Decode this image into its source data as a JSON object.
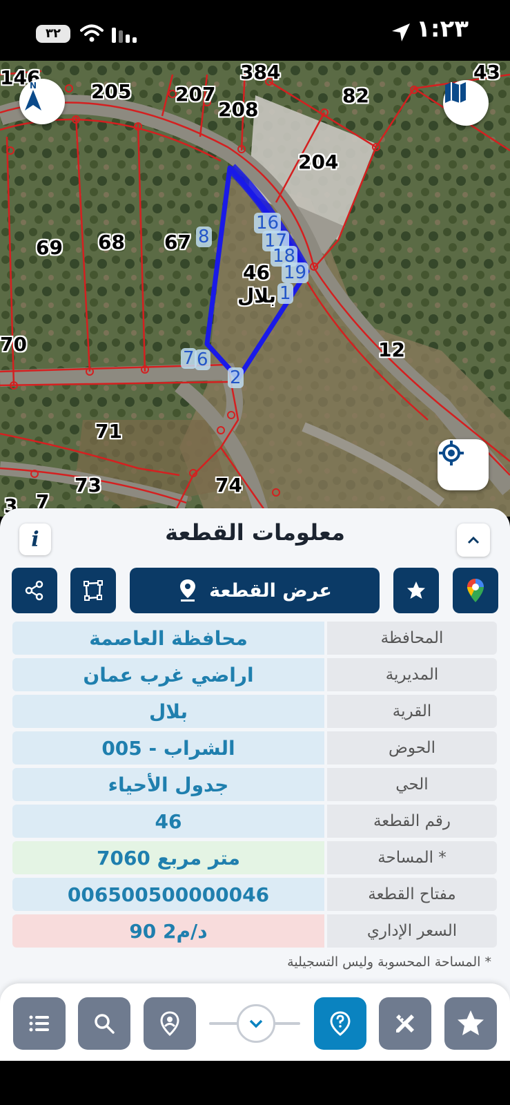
{
  "status_bar": {
    "time": "١:٢٣",
    "battery": "٣٢"
  },
  "map": {
    "parcel_labels": [
      "146",
      "205",
      "207",
      "384",
      "43",
      "82",
      "208",
      "204",
      "69",
      "68",
      "67",
      "46",
      "70",
      "12",
      "71",
      "73",
      "74",
      "3",
      "7"
    ],
    "village_label": "بلال",
    "boundary_points": [
      "8",
      "16",
      "17",
      "18",
      "19",
      "1",
      "2",
      "7",
      "6"
    ],
    "compass_label": "N"
  },
  "panel": {
    "title": "معلومات القطعة",
    "show_parcel_button": "عرض القطعة",
    "rows": [
      {
        "key": "المحافظة",
        "value": "محافظة العاصمة",
        "tone": "blue"
      },
      {
        "key": "المديرية",
        "value": "اراضي غرب عمان",
        "tone": "blue"
      },
      {
        "key": "القرية",
        "value": "بلال",
        "tone": "blue"
      },
      {
        "key": "الحوض",
        "value": "الشراب - 005",
        "tone": "blue"
      },
      {
        "key": "الحي",
        "value": "جدول الأحياء",
        "tone": "blue"
      },
      {
        "key": "رقم القطعة",
        "value": "46",
        "tone": "blue"
      },
      {
        "key": "المساحة *",
        "value": "7060  متر مربع",
        "tone": "green"
      },
      {
        "key": "مفتاح القطعة",
        "value": "006500500000046",
        "tone": "blue"
      },
      {
        "key": "السعر الإداري",
        "value": "90 د/م2",
        "tone": "red"
      }
    ],
    "footnote": "* المساحة المحسوبة وليس التسجيلية"
  },
  "colors": {
    "navy": "#0b3a66",
    "value_blue_bg": "#dcebf5",
    "value_green_bg": "#e4f4e4",
    "value_red_bg": "#f8dcdc",
    "accent_teal": "#0a83c0",
    "toolbar_gray": "#6f7b8f"
  }
}
